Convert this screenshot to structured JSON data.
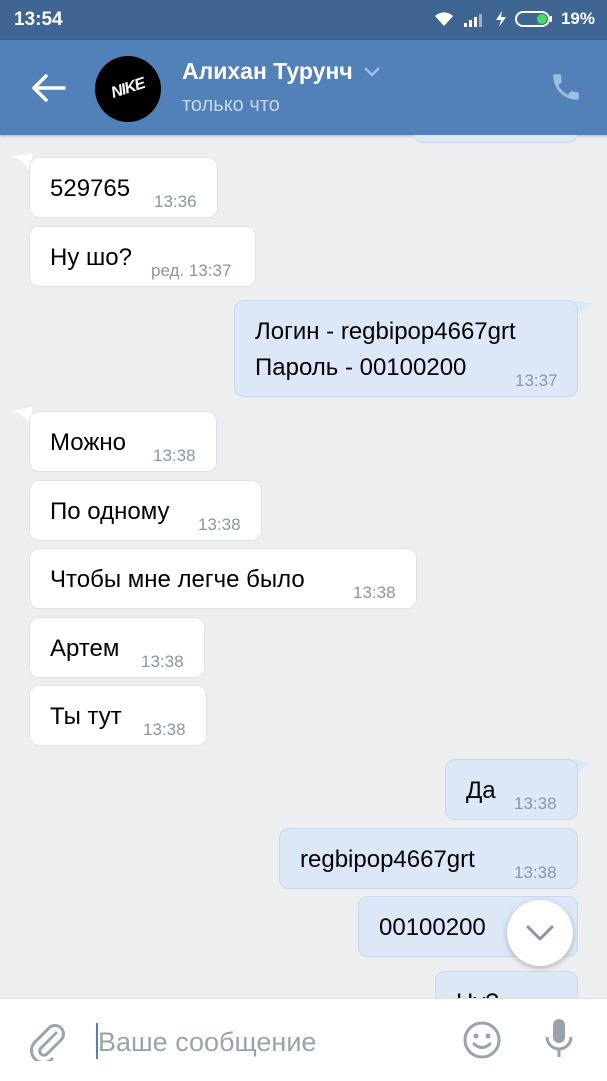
{
  "status_bar": {
    "time": "13:54",
    "battery": "19%"
  },
  "header": {
    "name": "Алихан Турунч",
    "status": "только что",
    "avatar_text": "NIKE"
  },
  "messages": [
    {
      "text": "529765",
      "time": "13:36"
    },
    {
      "text": "Ну шо?",
      "time": "ред. 13:37"
    },
    {
      "line1": "Логин - regbipop4667grt",
      "line2": "Пароль - 00100200",
      "time": "13:37"
    },
    {
      "text": "Можно",
      "time": "13:38"
    },
    {
      "text": "По одному",
      "time": "13:38"
    },
    {
      "text": "Чтобы мне легче было",
      "time": "13:38"
    },
    {
      "text": "Артем",
      "time": "13:38"
    },
    {
      "text": "Ты тут",
      "time": "13:38"
    },
    {
      "text": "Да",
      "time": "13:38"
    },
    {
      "text": "regbipop4667grt",
      "time": "13:38"
    },
    {
      "text": "00100200",
      "time": ""
    },
    {
      "text": "Ну?",
      "time": ""
    }
  ],
  "input": {
    "placeholder": "Ваше сообщение"
  },
  "colors": {
    "header": "#5181b8",
    "status_bar": "#3f6693",
    "background": "#edeef0",
    "outgoing_bubble": "#dce8f7",
    "incoming_bubble": "#ffffff"
  }
}
